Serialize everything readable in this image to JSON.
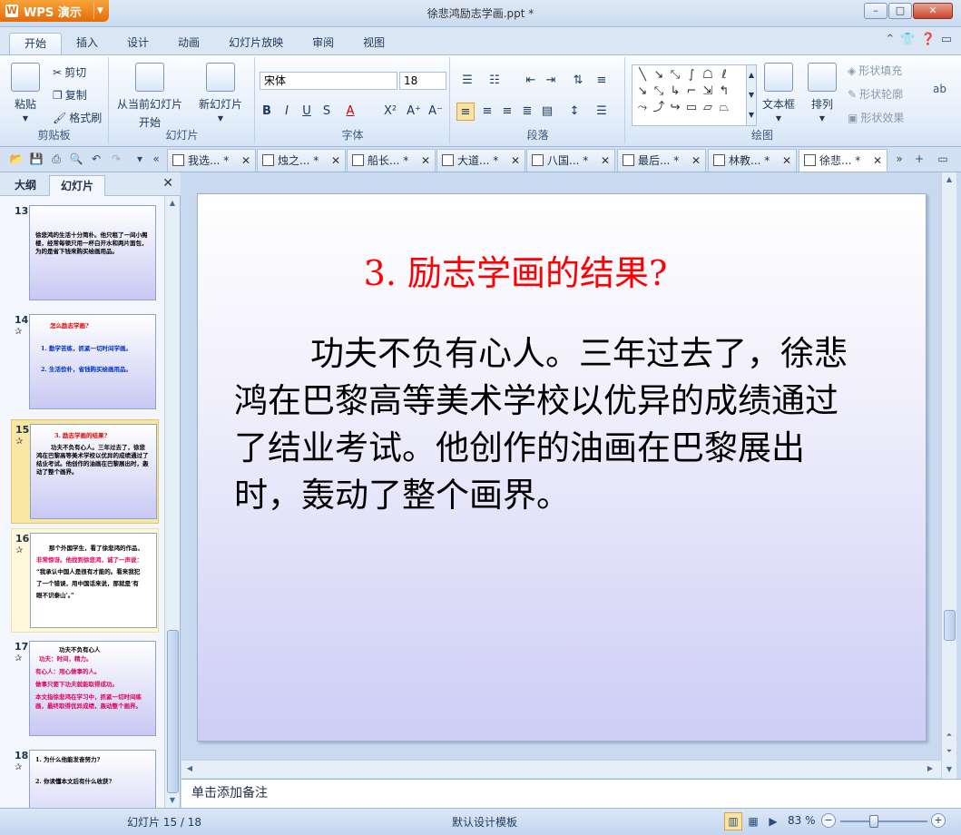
{
  "app": {
    "name": "WPS 演示",
    "doc_title": "徐悲鸿励志学画.ppt *"
  },
  "ribbon_tabs": [
    "开始",
    "插入",
    "设计",
    "动画",
    "幻灯片放映",
    "审阅",
    "视图"
  ],
  "ribbon": {
    "clipboard": {
      "paste": "粘贴",
      "cut": "剪切",
      "copy": "复制",
      "format_painter": "格式刷",
      "label": "剪贴板"
    },
    "slides": {
      "from_current": "从当前幻灯片",
      "from_current_2": "开始",
      "new_slide": "新幻灯片",
      "label": "幻灯片"
    },
    "font": {
      "name": "宋体",
      "size": "18",
      "label": "字体"
    },
    "paragraph": {
      "label": "段落"
    },
    "drawing": {
      "textbox": "文本框",
      "arrange": "排列",
      "shape_fill": "形状填充",
      "shape_outline": "形状轮廓",
      "shape_effect": "形状效果",
      "label": "绘图"
    }
  },
  "doc_tabs": [
    {
      "label": "我选... *"
    },
    {
      "label": "烛之... *"
    },
    {
      "label": "船长... *"
    },
    {
      "label": "大道... *"
    },
    {
      "label": "八国... *"
    },
    {
      "label": "最后... *"
    },
    {
      "label": "林教... *"
    },
    {
      "label": "徐悲... *"
    }
  ],
  "left_pane": {
    "tabs": [
      "大纲",
      "幻灯片"
    ],
    "thumbs": [
      {
        "num": "13",
        "lines": [
          "徐悲鸿的生活十分简朴。他只租了一间小阁楼，经常每顿只用一杯白开水和两片面包，为的是省下钱来购买绘画用品。"
        ]
      },
      {
        "num": "14",
        "title": "怎么励志学画?",
        "lines": [
          "1. 勤学苦练，抓紧一切时间学画。",
          "2. 生活俭朴，省钱购买绘画用品。"
        ]
      },
      {
        "num": "15",
        "title": "3. 励志学画的结果?",
        "lines": [
          "功夫不负有心人。三年过去了，徐悲鸿在巴黎高等美术学校以优异的成绩通过了结业考试。他创作的油画在巴黎展出时，轰动了整个画界。"
        ]
      },
      {
        "num": "16",
        "lines": [
          "那个外国学生，看了徐悲鸿的作品，",
          "非常惊讶。他找到徐悲鸿，诚了一声说：",
          "“我承认中国人是很有才能的。看来我犯",
          "了一个错误，用中国话来说，那就是‘有",
          "眼不识泰山’。”"
        ]
      },
      {
        "num": "17",
        "title": "功夫不负有心人",
        "lines": [
          "功夫：时间，精力。",
          "有心人：用心做事的人。",
          "做事只要下功夫就能取得成功。",
          "本文指徐悲鸿在学习中，抓紧一切时间练画，最终取得优异成绩，轰动整个画界。"
        ]
      },
      {
        "num": "18",
        "lines": [
          "1. 为什么他能发奋努力?",
          "2. 你读懂本文后有什么收获?"
        ]
      }
    ]
  },
  "slide": {
    "title": "3. 励志学画的结果?",
    "body": "功夫不负有心人。三年过去了，徐悲鸿在巴黎高等美术学校以优异的成绩通过了结业考试。他创作的油画在巴黎展出时，轰动了整个画界。"
  },
  "notes_placeholder": "单击添加备注",
  "status": {
    "slide_counter": "幻灯片 15 / 18",
    "template": "默认设计模板",
    "zoom": "83 %"
  }
}
